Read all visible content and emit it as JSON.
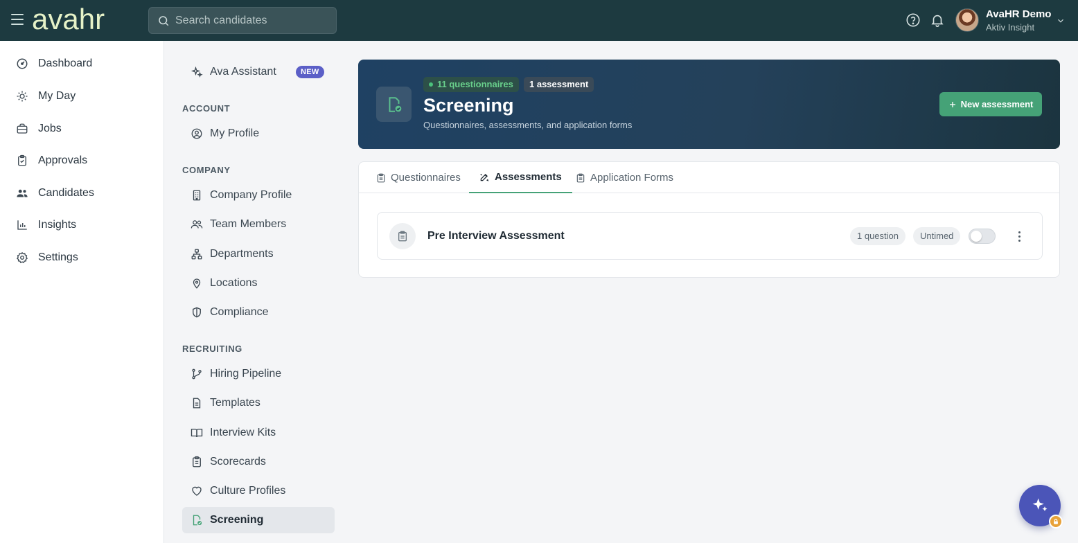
{
  "topbar": {
    "logo_text": "avahr",
    "search_placeholder": "Search candidates",
    "user_name": "AvaHR Demo",
    "user_org": "Aktiv Insight"
  },
  "main_nav": {
    "items": [
      {
        "label": "Dashboard",
        "icon": "dashboard-icon"
      },
      {
        "label": "My Day",
        "icon": "sun-icon"
      },
      {
        "label": "Jobs",
        "icon": "briefcase-icon"
      },
      {
        "label": "Approvals",
        "icon": "clipboard-check-icon"
      },
      {
        "label": "Candidates",
        "icon": "users-icon"
      },
      {
        "label": "Insights",
        "icon": "bar-chart-icon"
      },
      {
        "label": "Settings",
        "icon": "gear-icon"
      }
    ]
  },
  "settings_nav": {
    "assistant": {
      "label": "Ava Assistant",
      "badge": "NEW"
    },
    "account_heading": "ACCOUNT",
    "account_items": [
      {
        "label": "My Profile"
      }
    ],
    "company_heading": "COMPANY",
    "company_items": [
      {
        "label": "Company Profile"
      },
      {
        "label": "Team Members"
      },
      {
        "label": "Departments"
      },
      {
        "label": "Locations"
      },
      {
        "label": "Compliance"
      }
    ],
    "recruiting_heading": "RECRUITING",
    "recruiting_items": [
      {
        "label": "Hiring Pipeline"
      },
      {
        "label": "Templates"
      },
      {
        "label": "Interview Kits"
      },
      {
        "label": "Scorecards"
      },
      {
        "label": "Culture Profiles"
      },
      {
        "label": "Screening",
        "active": true
      }
    ]
  },
  "hero": {
    "questionnaires_pill": "11 questionnaires",
    "assessments_pill": "1 assessment",
    "title": "Screening",
    "subtitle": "Questionnaires, assessments, and application forms",
    "new_button_label": "New assessment"
  },
  "tabs": [
    {
      "label": "Questionnaires"
    },
    {
      "label": "Assessments",
      "active": true
    },
    {
      "label": "Application Forms"
    }
  ],
  "assessments": [
    {
      "title": "Pre Interview Assessment",
      "questions": "1 question",
      "timing": "Untimed",
      "enabled": false
    }
  ],
  "colors": {
    "topbar": "#1d3a40",
    "accent_green": "#45a277",
    "badge_purple": "#5b5fc7",
    "fab": "#4b55b8"
  }
}
